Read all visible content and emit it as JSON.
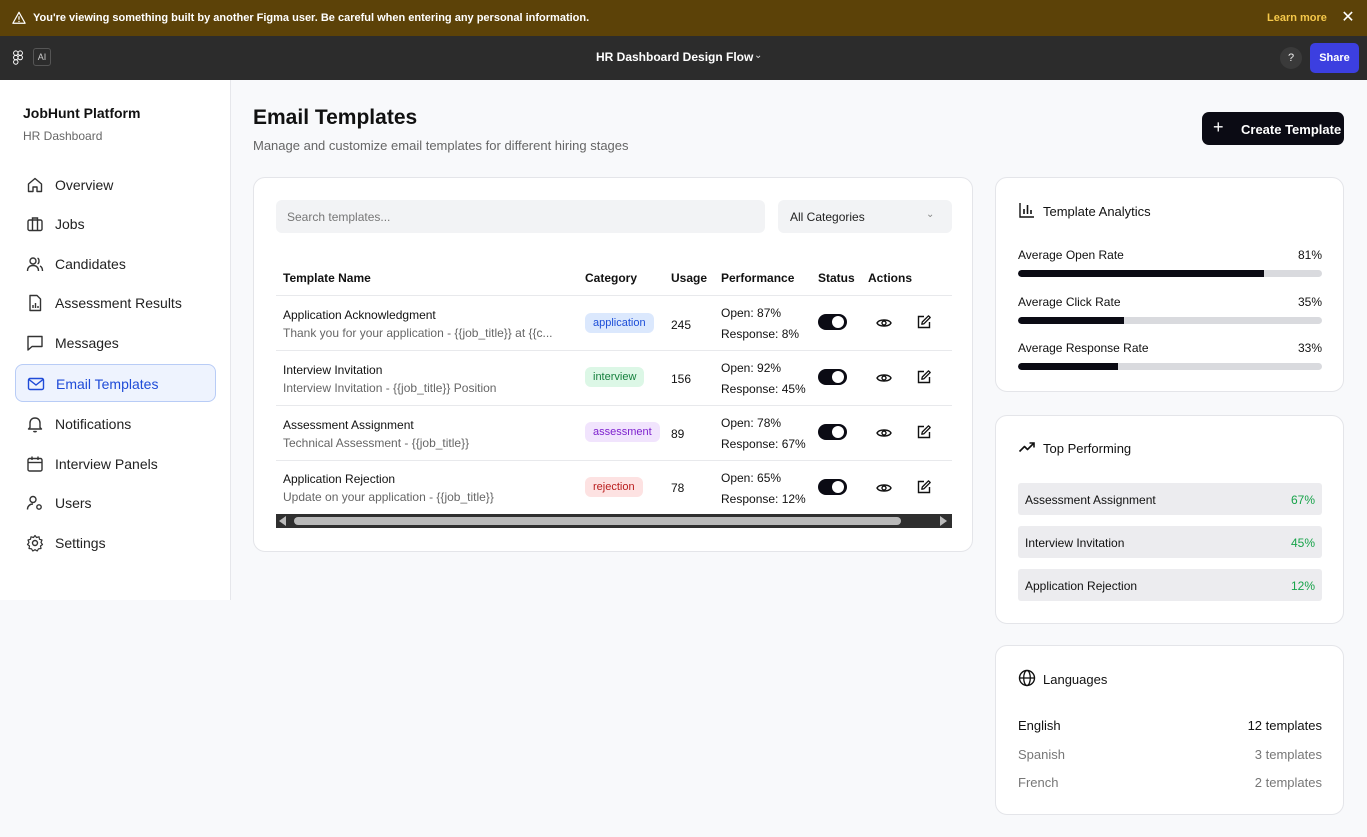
{
  "banner": {
    "message": "You're viewing something built by another Figma user. Be careful when entering any personal information.",
    "learn_more": "Learn more",
    "close": "✕"
  },
  "toolbar": {
    "ai_label": "AI",
    "file_title": "HR Dashboard Design Flow",
    "help": "?",
    "share": "Share"
  },
  "sidebar": {
    "brand": "JobHunt Platform",
    "subtitle": "HR Dashboard",
    "items": [
      {
        "label": "Overview",
        "icon": "home-icon"
      },
      {
        "label": "Jobs",
        "icon": "briefcase-icon"
      },
      {
        "label": "Candidates",
        "icon": "users-icon"
      },
      {
        "label": "Assessment Results",
        "icon": "report-icon"
      },
      {
        "label": "Messages",
        "icon": "message-icon"
      },
      {
        "label": "Email Templates",
        "icon": "mail-icon",
        "active": true
      },
      {
        "label": "Notifications",
        "icon": "bell-icon"
      },
      {
        "label": "Interview Panels",
        "icon": "calendar-icon"
      },
      {
        "label": "Users",
        "icon": "user-gear-icon"
      },
      {
        "label": "Settings",
        "icon": "gear-icon"
      }
    ]
  },
  "header": {
    "title": "Email Templates",
    "subtitle": "Manage and customize email templates for different hiring stages",
    "create_button": "Create Template"
  },
  "filters": {
    "search_placeholder": "Search templates...",
    "category_value": "All Categories"
  },
  "table": {
    "columns": [
      "Template Name",
      "Category",
      "Usage",
      "Performance",
      "Status",
      "Actions"
    ],
    "rows": [
      {
        "name": "Application Acknowledgment",
        "subject": "Thank you for your application - {{job_title}} at {{c...",
        "category": "application",
        "usage": "245",
        "open": "Open: 87%",
        "response": "Response: 8%",
        "enabled": true
      },
      {
        "name": "Interview Invitation",
        "subject": "Interview Invitation - {{job_title}} Position",
        "category": "interview",
        "usage": "156",
        "open": "Open: 92%",
        "response": "Response: 45%",
        "enabled": true
      },
      {
        "name": "Assessment Assignment",
        "subject": "Technical Assessment - {{job_title}}",
        "category": "assessment",
        "usage": "89",
        "open": "Open: 78%",
        "response": "Response: 67%",
        "enabled": true
      },
      {
        "name": "Application Rejection",
        "subject": "Update on your application - {{job_title}}",
        "category": "rejection",
        "usage": "78",
        "open": "Open: 65%",
        "response": "Response: 12%",
        "enabled": true
      }
    ]
  },
  "category_colors": {
    "application": {
      "bg": "#dbe8fd",
      "fg": "#1d4ed8"
    },
    "interview": {
      "bg": "#dcf7e6",
      "fg": "#15803d"
    },
    "assessment": {
      "bg": "#f1e4fd",
      "fg": "#7e22ce"
    },
    "rejection": {
      "bg": "#fde2e2",
      "fg": "#b91c1c"
    }
  },
  "analytics": {
    "title": "Template Analytics",
    "metrics": [
      {
        "label": "Average Open Rate",
        "value": "81%",
        "fraction": 0.81
      },
      {
        "label": "Average Click Rate",
        "value": "35%",
        "fraction": 0.35
      },
      {
        "label": "Average Response Rate",
        "value": "33%",
        "fraction": 0.33
      }
    ]
  },
  "top_performing": {
    "title": "Top Performing",
    "items": [
      {
        "name": "Assessment Assignment",
        "value": "67%"
      },
      {
        "name": "Interview Invitation",
        "value": "45%"
      },
      {
        "name": "Application Rejection",
        "value": "12%"
      }
    ]
  },
  "languages": {
    "title": "Languages",
    "items": [
      {
        "name": "English",
        "count": "12 templates"
      },
      {
        "name": "Spanish",
        "count": "3 templates"
      },
      {
        "name": "French",
        "count": "2 templates"
      }
    ]
  },
  "colors": {
    "accent": "#1f4bd8",
    "share": "#3c3fe0",
    "banner": "#5c4208",
    "success": "#17a34a"
  }
}
